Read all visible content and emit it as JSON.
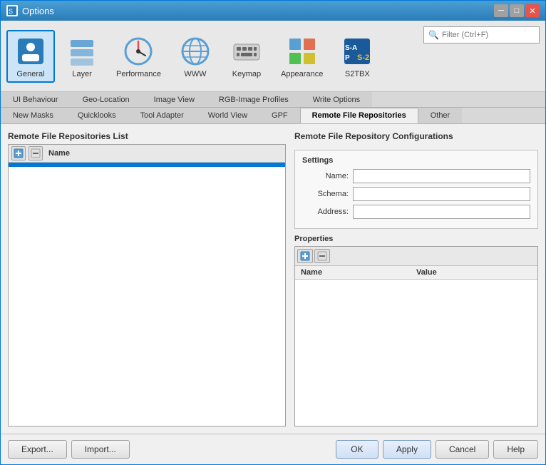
{
  "window": {
    "title": "Options"
  },
  "toolbar": {
    "items": [
      {
        "id": "general",
        "label": "General",
        "active": true
      },
      {
        "id": "layer",
        "label": "Layer",
        "active": false
      },
      {
        "id": "performance",
        "label": "Performance",
        "active": false
      },
      {
        "id": "www",
        "label": "WWW",
        "active": false
      },
      {
        "id": "keymap",
        "label": "Keymap",
        "active": false
      },
      {
        "id": "appearance",
        "label": "Appearance",
        "active": false
      },
      {
        "id": "s2tbx",
        "label": "S2TBX",
        "active": false
      }
    ],
    "search_placeholder": "Filter (Ctrl+F)"
  },
  "tabs_row1": [
    {
      "id": "ui-behaviour",
      "label": "UI Behaviour",
      "active": false
    },
    {
      "id": "geo-location",
      "label": "Geo-Location",
      "active": false
    },
    {
      "id": "image-view",
      "label": "Image View",
      "active": false
    },
    {
      "id": "rgb-image-profiles",
      "label": "RGB-Image Profiles",
      "active": false
    },
    {
      "id": "write-options",
      "label": "Write Options",
      "active": false
    }
  ],
  "tabs_row2": [
    {
      "id": "new-masks",
      "label": "New Masks",
      "active": false
    },
    {
      "id": "quicklooks",
      "label": "Quicklooks",
      "active": false
    },
    {
      "id": "tool-adapter",
      "label": "Tool Adapter",
      "active": false
    },
    {
      "id": "world-view",
      "label": "World View",
      "active": false
    },
    {
      "id": "gpf",
      "label": "GPF",
      "active": false
    },
    {
      "id": "remote-file-repos",
      "label": "Remote File Repositories",
      "active": true
    },
    {
      "id": "other",
      "label": "Other",
      "active": false
    }
  ],
  "left_panel": {
    "title": "Remote File Repositories List",
    "column_header": "Name",
    "add_btn": "+",
    "remove_btn": "−"
  },
  "right_panel": {
    "title": "Remote File Repository Configurations",
    "settings": {
      "title": "Settings",
      "fields": [
        {
          "label": "Name:",
          "value": ""
        },
        {
          "label": "Schema:",
          "value": ""
        },
        {
          "label": "Address:",
          "value": ""
        }
      ]
    },
    "properties": {
      "title": "Properties",
      "columns": [
        {
          "label": "Name"
        },
        {
          "label": "Value"
        }
      ],
      "add_btn": "+",
      "remove_btn": "−"
    }
  },
  "bottom_buttons": {
    "export": "Export...",
    "import": "Import...",
    "ok": "OK",
    "apply": "Apply",
    "cancel": "Cancel",
    "help": "Help"
  }
}
